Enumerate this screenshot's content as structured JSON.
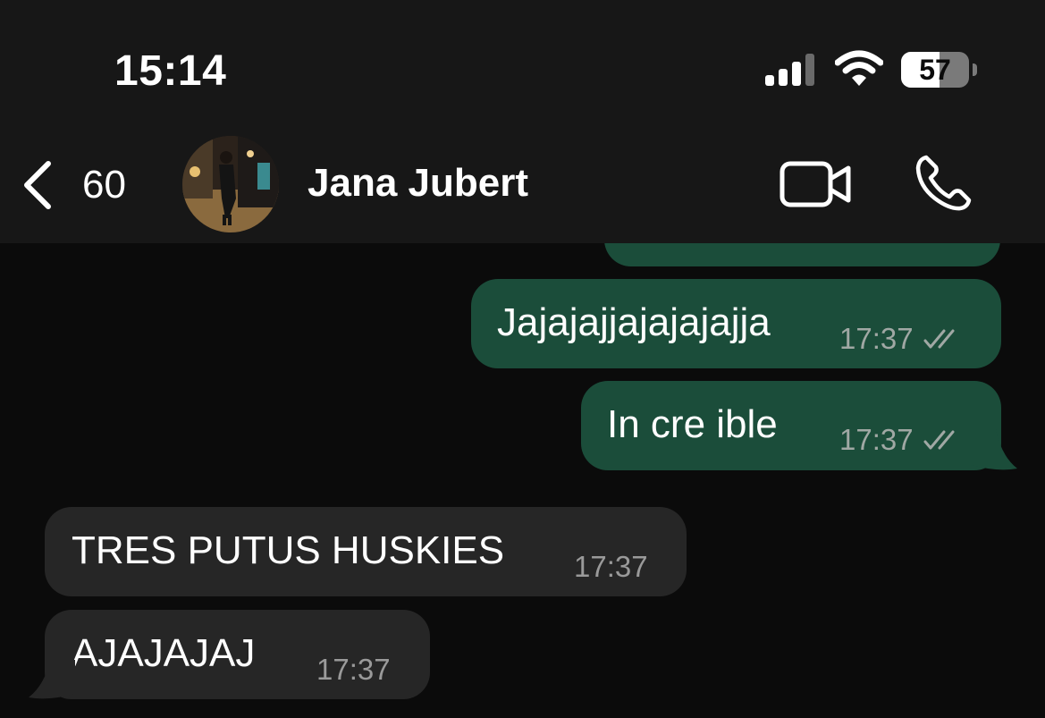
{
  "status_bar": {
    "time": "15:14",
    "battery_percent": "57",
    "battery_level": 0.57
  },
  "header": {
    "back_count": "60",
    "contact_name": "Jana Jubert",
    "icons": [
      "chevron-left-icon",
      "video-camera-icon",
      "phone-icon"
    ]
  },
  "messages": [
    {
      "direction": "out",
      "text": "Jajajajjajajajajja",
      "time": "17:37",
      "status": "read"
    },
    {
      "direction": "out",
      "text": "In cre ible",
      "time": "17:37",
      "status": "read"
    },
    {
      "direction": "in",
      "text": "TRES PUTUS HUSKIES",
      "time": "17:37"
    },
    {
      "direction": "in",
      "text": "AJAJAJAJ",
      "time": "17:37"
    }
  ],
  "colors": {
    "header_bg": "#171717",
    "chat_bg": "#0b0b0b",
    "outgoing_bubble": "#1b4d3a",
    "incoming_bubble": "#262626"
  }
}
